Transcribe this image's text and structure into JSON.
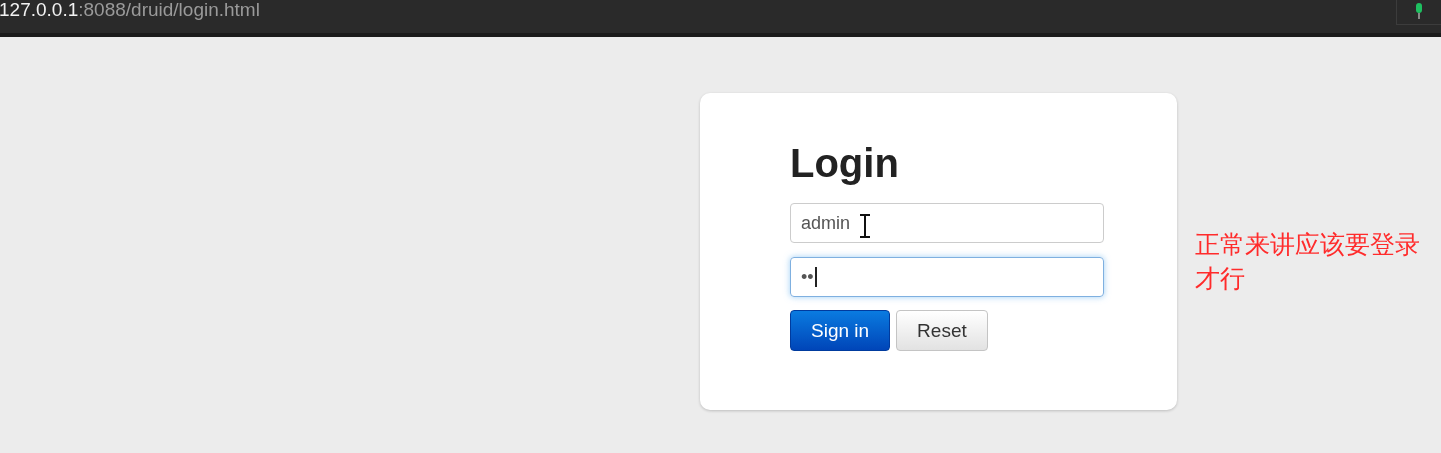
{
  "browser": {
    "address_host": "127.0.0.1",
    "address_path": ":8088/druid/login.html"
  },
  "login": {
    "title": "Login",
    "username": {
      "value": "admin",
      "focused": false
    },
    "password": {
      "value": "••",
      "focused": true
    },
    "buttons": [
      {
        "label": "Sign in",
        "kind": "primary"
      },
      {
        "label": "Reset",
        "kind": "default"
      }
    ]
  },
  "annotation": {
    "text": "正常来讲应该要登录才行",
    "color": "#ff2b2b"
  }
}
